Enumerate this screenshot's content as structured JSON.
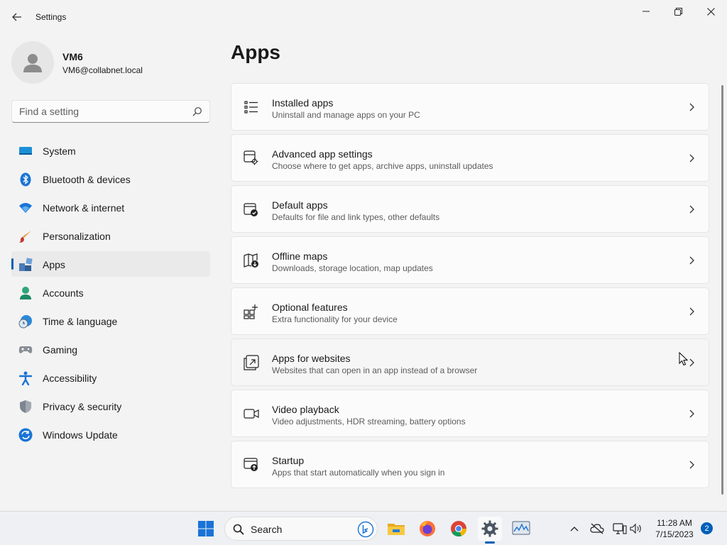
{
  "window": {
    "title": "Settings"
  },
  "user": {
    "name": "VM6",
    "email": "VM6@collabnet.local"
  },
  "search": {
    "placeholder": "Find a setting"
  },
  "nav": {
    "items": [
      {
        "label": "System",
        "icon": "monitor-icon"
      },
      {
        "label": "Bluetooth & devices",
        "icon": "bluetooth-icon"
      },
      {
        "label": "Network & internet",
        "icon": "wifi-icon"
      },
      {
        "label": "Personalization",
        "icon": "brush-icon"
      },
      {
        "label": "Apps",
        "icon": "apps-icon",
        "selected": true
      },
      {
        "label": "Accounts",
        "icon": "person-icon"
      },
      {
        "label": "Time & language",
        "icon": "globe-clock-icon"
      },
      {
        "label": "Gaming",
        "icon": "gamepad-icon"
      },
      {
        "label": "Accessibility",
        "icon": "accessibility-icon"
      },
      {
        "label": "Privacy & security",
        "icon": "shield-icon"
      },
      {
        "label": "Windows Update",
        "icon": "update-icon"
      }
    ]
  },
  "main": {
    "title": "Apps",
    "cards": [
      {
        "title": "Installed apps",
        "subtitle": "Uninstall and manage apps on your PC",
        "icon": "list-icon"
      },
      {
        "title": "Advanced app settings",
        "subtitle": "Choose where to get apps, archive apps, uninstall updates",
        "icon": "app-settings-icon"
      },
      {
        "title": "Default apps",
        "subtitle": "Defaults for file and link types, other defaults",
        "icon": "default-apps-icon"
      },
      {
        "title": "Offline maps",
        "subtitle": "Downloads, storage location, map updates",
        "icon": "map-download-icon"
      },
      {
        "title": "Optional features",
        "subtitle": "Extra functionality for your device",
        "icon": "add-feature-icon"
      },
      {
        "title": "Apps for websites",
        "subtitle": "Websites that can open in an app instead of a browser",
        "icon": "open-in-app-icon"
      },
      {
        "title": "Video playback",
        "subtitle": "Video adjustments, HDR streaming, battery options",
        "icon": "video-icon"
      },
      {
        "title": "Startup",
        "subtitle": "Apps that start automatically when you sign in",
        "icon": "startup-icon"
      }
    ]
  },
  "taskbar": {
    "search_label": "Search",
    "apps": [
      "start-icon",
      "file-explorer-icon",
      "firefox-icon",
      "chrome-icon",
      "settings-icon",
      "task-manager-icon"
    ],
    "active_app": "settings-icon",
    "time": "11:28 AM",
    "date": "7/15/2023",
    "notification_count": "2"
  },
  "colors": {
    "accent": "#005fb8",
    "background": "#f3f3f3",
    "card": "#fbfbfb"
  }
}
